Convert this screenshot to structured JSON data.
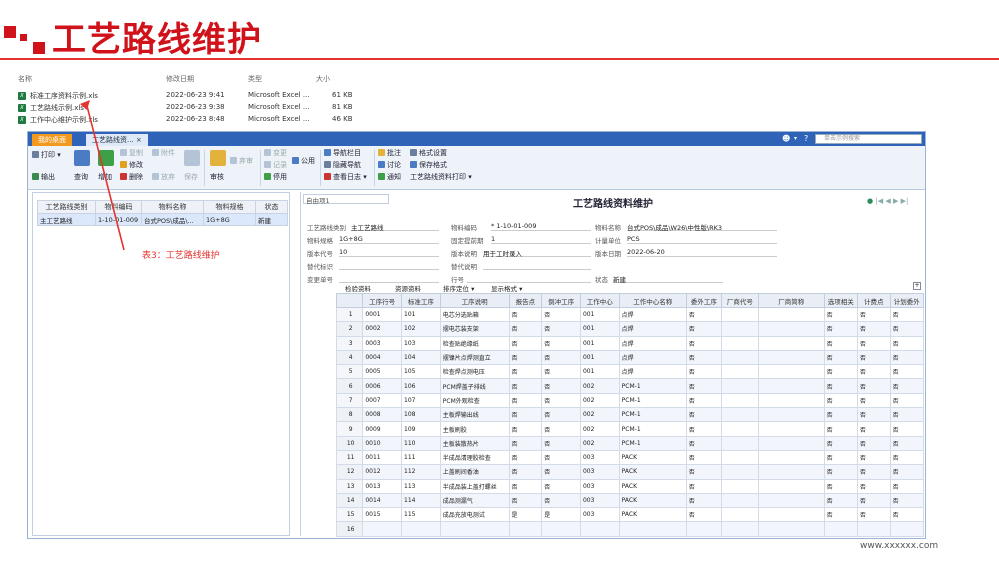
{
  "slide": {
    "title": "工艺路线维护",
    "accent_color": "#d0121b",
    "watermark": "www.xxxxxx.com"
  },
  "explorer": {
    "headers": {
      "name": "名称",
      "date": "修改日期",
      "type": "类型",
      "size": "大小"
    },
    "files": [
      {
        "name": "标准工序资料示例.xls",
        "date": "2022-06-23 9:41",
        "type": "Microsoft Excel ...",
        "size": "61 KB"
      },
      {
        "name": "工艺路线示例.xls",
        "date": "2022-06-23 9:38",
        "type": "Microsoft Excel ...",
        "size": "81 KB"
      },
      {
        "name": "工作中心维护示例.xls",
        "date": "2022-06-23 8:48",
        "type": "Microsoft Excel ...",
        "size": "46 KB"
      }
    ]
  },
  "app": {
    "tabs": {
      "home": "我的桌面",
      "current": "工艺路线资..."
    },
    "search_placeholder": "单击示例搜索",
    "ribbon": {
      "print": "打印",
      "output": "输出",
      "query": "查询",
      "add": "增加",
      "copy": "复制",
      "modify": "修改",
      "delete": "删除",
      "attach": "附件",
      "discard": "放弃",
      "save": "保存",
      "audit": "审核",
      "abandon_audit": "弃审",
      "change": "变更",
      "record": "记录",
      "pause": "停用",
      "public": "公用",
      "nav_bar": "导航栏目",
      "hide_nav": "隐藏导航",
      "view_log": "查看日志",
      "annotate": "批注",
      "discuss": "讨论",
      "notify": "通知",
      "format_settings": "格式设置",
      "save_format": "保存格式",
      "print_route": "工艺路线资料打印"
    },
    "left_table": {
      "headers": [
        "工艺路线类别",
        "物料编码",
        "物料名称",
        "物料规格",
        "状态"
      ],
      "rows": [
        [
          "主工艺路线",
          "1-10-01-009",
          "台式POS\\成品\\...",
          "1G+8G",
          "新建"
        ]
      ]
    },
    "annotation": "表3：工艺路线维护",
    "form": {
      "template_label": "自由项1",
      "title": "工艺路线资料维护",
      "fields": {
        "route_type_lbl": "工艺路线类别",
        "route_type": "主工艺路线",
        "mat_code_lbl": "物料编码",
        "mat_code": "1-10-01-009",
        "mat_name_lbl": "物料名称",
        "mat_name": "台式POS\\成品\\W26\\中性版\\RK3",
        "mat_spec_lbl": "物料规格",
        "mat_spec": "1G+8G",
        "fixed_lead_lbl": "固定提前期",
        "fixed_lead": "1",
        "unit_lbl": "计量单位",
        "unit": "PCS",
        "ver_lbl": "版本代号",
        "ver": "10",
        "ver_desc_lbl": "版本说明",
        "ver_desc": "用于工时录入",
        "ver_date_lbl": "版本日期",
        "ver_date": "2022-06-20",
        "alt_flag_lbl": "替代标识",
        "alt_desc_lbl": "替代说明",
        "change_no_lbl": "变更单号",
        "line_lbl": "行号",
        "status_lbl": "状态",
        "status": "新建"
      },
      "grid_toolbar": [
        "检验资料",
        "资源资料",
        "排序定位",
        "显示格式"
      ],
      "grid_headers": [
        "",
        "工序行号",
        "标准工序",
        "工序说明",
        "报告点",
        "倒冲工序",
        "工作中心",
        "工作中心名称",
        "委外工序",
        "厂商代号",
        "厂商简称",
        "选项相关",
        "计费点",
        "计划委外"
      ],
      "grid_rows": [
        [
          "1",
          "0001",
          "101",
          "电芯分选贴箱",
          "否",
          "否",
          "001",
          "点焊",
          "否",
          "",
          "",
          "否",
          "否",
          "否"
        ],
        [
          "2",
          "0002",
          "102",
          "摆电芯装支架",
          "否",
          "否",
          "001",
          "点焊",
          "否",
          "",
          "",
          "否",
          "否",
          "否"
        ],
        [
          "3",
          "0003",
          "103",
          "检查贴绝缘纸",
          "否",
          "否",
          "001",
          "点焊",
          "否",
          "",
          "",
          "否",
          "否",
          "否"
        ],
        [
          "4",
          "0004",
          "104",
          "摆镍片点焊测直立",
          "否",
          "否",
          "001",
          "点焊",
          "否",
          "",
          "",
          "否",
          "否",
          "否"
        ],
        [
          "5",
          "0005",
          "105",
          "检查焊点测电压",
          "否",
          "否",
          "001",
          "点焊",
          "否",
          "",
          "",
          "否",
          "否",
          "否"
        ],
        [
          "6",
          "0006",
          "106",
          "PCM焊盖子排线",
          "否",
          "否",
          "002",
          "PCM-1",
          "否",
          "",
          "",
          "否",
          "否",
          "否"
        ],
        [
          "7",
          "0007",
          "107",
          "PCM外观检查",
          "否",
          "否",
          "002",
          "PCM-1",
          "否",
          "",
          "",
          "否",
          "否",
          "否"
        ],
        [
          "8",
          "0008",
          "108",
          "主板焊输出线",
          "否",
          "否",
          "002",
          "PCM-1",
          "否",
          "",
          "",
          "否",
          "否",
          "否"
        ],
        [
          "9",
          "0009",
          "109",
          "主板刷胶",
          "否",
          "否",
          "002",
          "PCM-1",
          "否",
          "",
          "",
          "否",
          "否",
          "否"
        ],
        [
          "10",
          "0010",
          "110",
          "主板装散热片",
          "否",
          "否",
          "002",
          "PCM-1",
          "否",
          "",
          "",
          "否",
          "否",
          "否"
        ],
        [
          "11",
          "0011",
          "111",
          "半成品清理胶检查",
          "否",
          "否",
          "003",
          "PACK",
          "否",
          "",
          "",
          "否",
          "否",
          "否"
        ],
        [
          "12",
          "0012",
          "112",
          "上盖刷间香油",
          "否",
          "否",
          "003",
          "PACK",
          "否",
          "",
          "",
          "否",
          "否",
          "否"
        ],
        [
          "13",
          "0013",
          "113",
          "半成品装上盖打螺丝",
          "否",
          "否",
          "003",
          "PACK",
          "否",
          "",
          "",
          "否",
          "否",
          "否"
        ],
        [
          "14",
          "0014",
          "114",
          "成品测漏气",
          "否",
          "否",
          "003",
          "PACK",
          "否",
          "",
          "",
          "否",
          "否",
          "否"
        ],
        [
          "15",
          "0015",
          "115",
          "成品充放电测试",
          "是",
          "是",
          "003",
          "PACK",
          "否",
          "",
          "",
          "否",
          "否",
          "否"
        ],
        [
          "16",
          "",
          "",
          "",
          "",
          "",
          "",
          "",
          "",
          "",
          "",
          "",
          "",
          ""
        ]
      ]
    }
  }
}
